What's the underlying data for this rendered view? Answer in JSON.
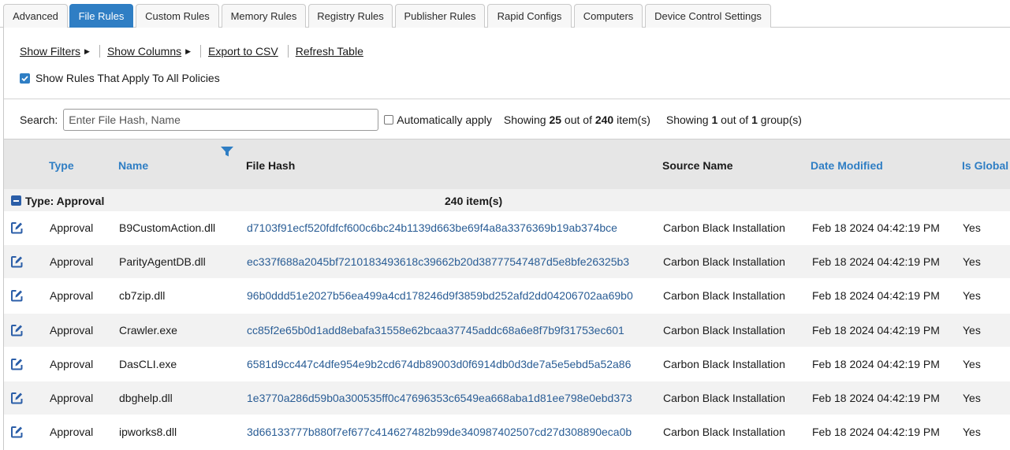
{
  "tabs": [
    {
      "label": "Advanced",
      "active": false
    },
    {
      "label": "File Rules",
      "active": true
    },
    {
      "label": "Custom Rules",
      "active": false
    },
    {
      "label": "Memory Rules",
      "active": false
    },
    {
      "label": "Registry Rules",
      "active": false
    },
    {
      "label": "Publisher Rules",
      "active": false
    },
    {
      "label": "Rapid Configs",
      "active": false
    },
    {
      "label": "Computers",
      "active": false
    },
    {
      "label": "Device Control Settings",
      "active": false
    }
  ],
  "toolbar": {
    "show_filters": "Show Filters",
    "show_columns": "Show Columns",
    "export_csv": "Export to CSV",
    "refresh": "Refresh Table"
  },
  "apply_all": {
    "label": "Show Rules That Apply To All Policies",
    "checked": true
  },
  "search": {
    "label": "Search:",
    "placeholder": "Enter File Hash, Name",
    "auto_label": "Automatically apply",
    "auto_checked": false,
    "showing_prefix": "Showing ",
    "showing_count": "25",
    "showing_mid": " out of ",
    "showing_total": "240",
    "showing_suffix": " item(s)",
    "groups_prefix": "Showing ",
    "groups_count": "1",
    "groups_mid": " out of ",
    "groups_total": "1",
    "groups_suffix": " group(s)"
  },
  "columns": {
    "type": "Type",
    "name": "Name",
    "hash": "File Hash",
    "source": "Source Name",
    "date": "Date Modified",
    "global": "Is Global"
  },
  "group": {
    "title": "Type: Approval",
    "count": "240 item(s)"
  },
  "rows": [
    {
      "type": "Approval",
      "name": "B9CustomAction.dll",
      "hash": "d7103f91ecf520fdfcf600c6bc24b1139d663be69f4a8a3376369b19ab374bce",
      "source": "Carbon Black Installation",
      "date": "Feb 18 2024 04:42:19 PM",
      "global": "Yes"
    },
    {
      "type": "Approval",
      "name": "ParityAgentDB.dll",
      "hash": "ec337f688a2045bf7210183493618c39662b20d38777547487d5e8bfe26325b3",
      "source": "Carbon Black Installation",
      "date": "Feb 18 2024 04:42:19 PM",
      "global": "Yes"
    },
    {
      "type": "Approval",
      "name": "cb7zip.dll",
      "hash": "96b0ddd51e2027b56ea499a4cd178246d9f3859bd252afd2dd04206702aa69b0",
      "source": "Carbon Black Installation",
      "date": "Feb 18 2024 04:42:19 PM",
      "global": "Yes"
    },
    {
      "type": "Approval",
      "name": "Crawler.exe",
      "hash": "cc85f2e65b0d1add8ebafa31558e62bcaa37745addc68a6e8f7b9f31753ec601",
      "source": "Carbon Black Installation",
      "date": "Feb 18 2024 04:42:19 PM",
      "global": "Yes"
    },
    {
      "type": "Approval",
      "name": "DasCLI.exe",
      "hash": "6581d9cc447c4dfe954e9b2cd674db89003d0f6914db0d3de7a5e5ebd5a52a86",
      "source": "Carbon Black Installation",
      "date": "Feb 18 2024 04:42:19 PM",
      "global": "Yes"
    },
    {
      "type": "Approval",
      "name": "dbghelp.dll",
      "hash": "1e3770a286d59b0a300535ff0c47696353c6549ea668aba1d81ee798e0ebd373",
      "source": "Carbon Black Installation",
      "date": "Feb 18 2024 04:42:19 PM",
      "global": "Yes"
    },
    {
      "type": "Approval",
      "name": "ipworks8.dll",
      "hash": "3d66133777b880f7ef677c414627482b99de340987402507cd27d308890eca0b",
      "source": "Carbon Black Installation",
      "date": "Feb 18 2024 04:42:19 PM",
      "global": "Yes"
    }
  ],
  "colors": {
    "accent": "#2f7ec4",
    "hash_link": "#2a5d95",
    "edit_icon": "#2b5ea8"
  },
  "icons": {
    "edit": "edit-icon",
    "filter": "filter-icon",
    "collapse": "minus-icon"
  }
}
